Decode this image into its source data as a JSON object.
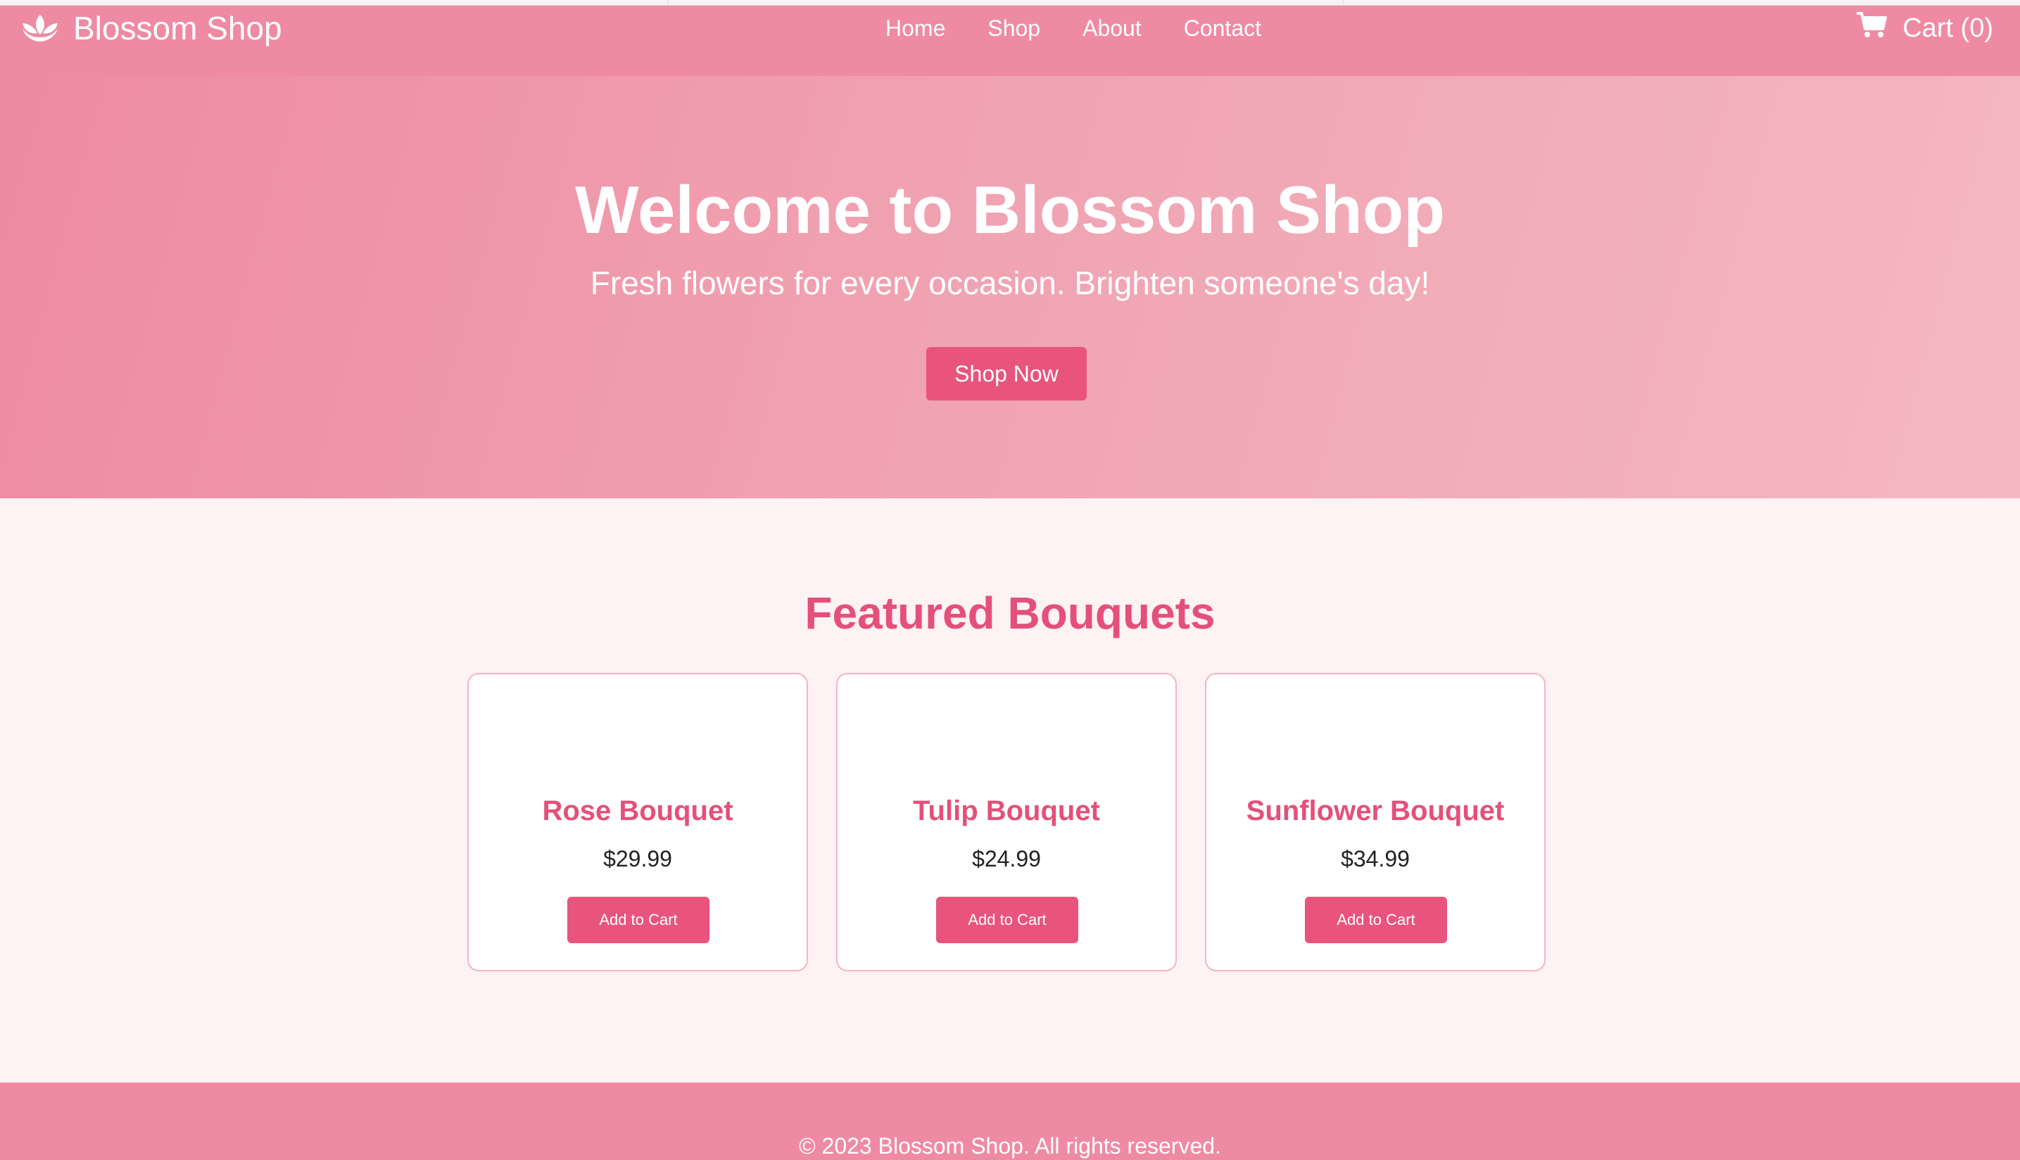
{
  "header": {
    "brand_name": "Blossom Shop",
    "brand_icon": "lotus-icon",
    "nav": [
      "Home",
      "Shop",
      "About",
      "Contact"
    ],
    "cart_label": "Cart (0)",
    "cart_icon": "shopping-cart-icon"
  },
  "hero": {
    "title": "Welcome to Blossom Shop",
    "subtitle": "Fresh flowers for every occasion. Brighten someone's day!",
    "cta_label": "Shop Now"
  },
  "featured": {
    "title": "Featured Bouquets",
    "products": [
      {
        "name": "Rose Bouquet",
        "price": "$29.99",
        "button": "Add to Cart"
      },
      {
        "name": "Tulip Bouquet",
        "price": "$24.99",
        "button": "Add to Cart"
      },
      {
        "name": "Sunflower Bouquet",
        "price": "$34.99",
        "button": "Add to Cart"
      }
    ]
  },
  "footer": {
    "copyright": "© 2023 Blossom Shop. All rights reserved."
  },
  "colors": {
    "header_bg": "#ef8aa3",
    "accent": "#e8547c",
    "heading_pink": "#e4507a",
    "page_bg": "#fdf2f4",
    "card_border": "#f6b3c2"
  }
}
